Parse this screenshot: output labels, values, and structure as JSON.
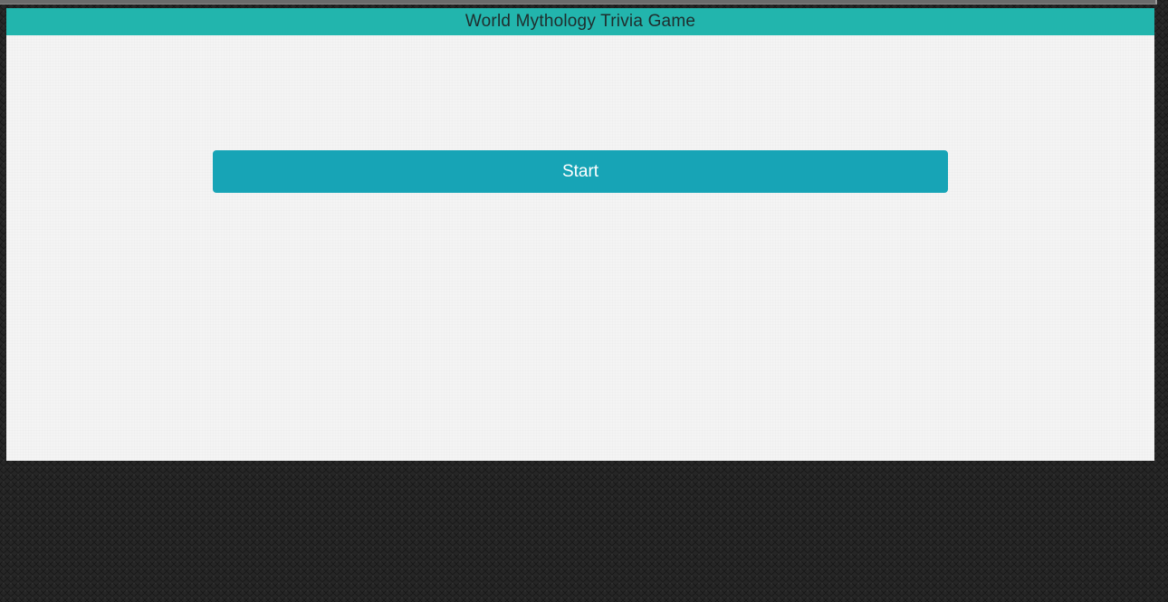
{
  "app": {
    "title": "World Mythology Trivia Game"
  },
  "main": {
    "start_label": "Start"
  },
  "colors": {
    "title_bar": "#22b5ad",
    "start_button": "#17a4b6",
    "panel_background": "#f4f4f4",
    "desktop_background": "#262626"
  }
}
